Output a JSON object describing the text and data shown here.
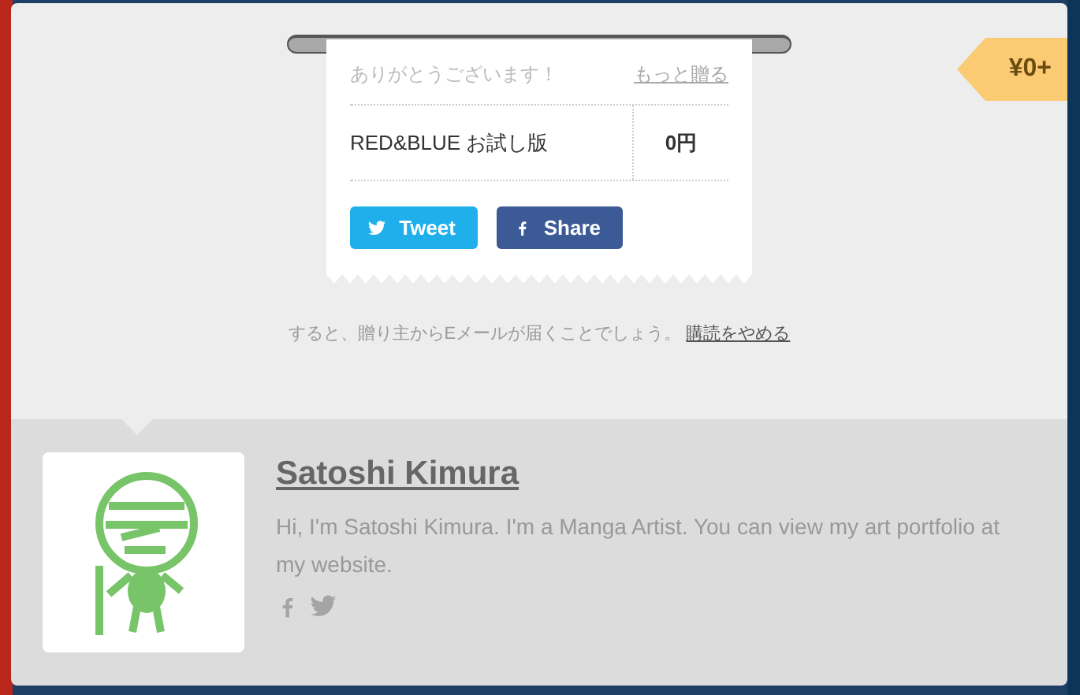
{
  "price_tag": "¥0+",
  "receipt": {
    "thanks": "ありがとうございます！",
    "more_link": "もっと贈る",
    "item": {
      "name": "RED&BLUE お試し版",
      "price": "0円"
    },
    "share_buttons": [
      {
        "kind": "twitter",
        "label": "Tweet"
      },
      {
        "kind": "facebook",
        "label": "Share"
      }
    ]
  },
  "note": {
    "text": "すると、贈り主からEメールが届くことでしょう。",
    "link": "購読をやめる"
  },
  "author": {
    "name": "Satoshi Kimura",
    "bio": "Hi, I'm Satoshi Kimura. I'm a Manga Artist. You can view my art portfolio at my website.",
    "social": [
      {
        "kind": "facebook"
      },
      {
        "kind": "twitter"
      }
    ]
  }
}
